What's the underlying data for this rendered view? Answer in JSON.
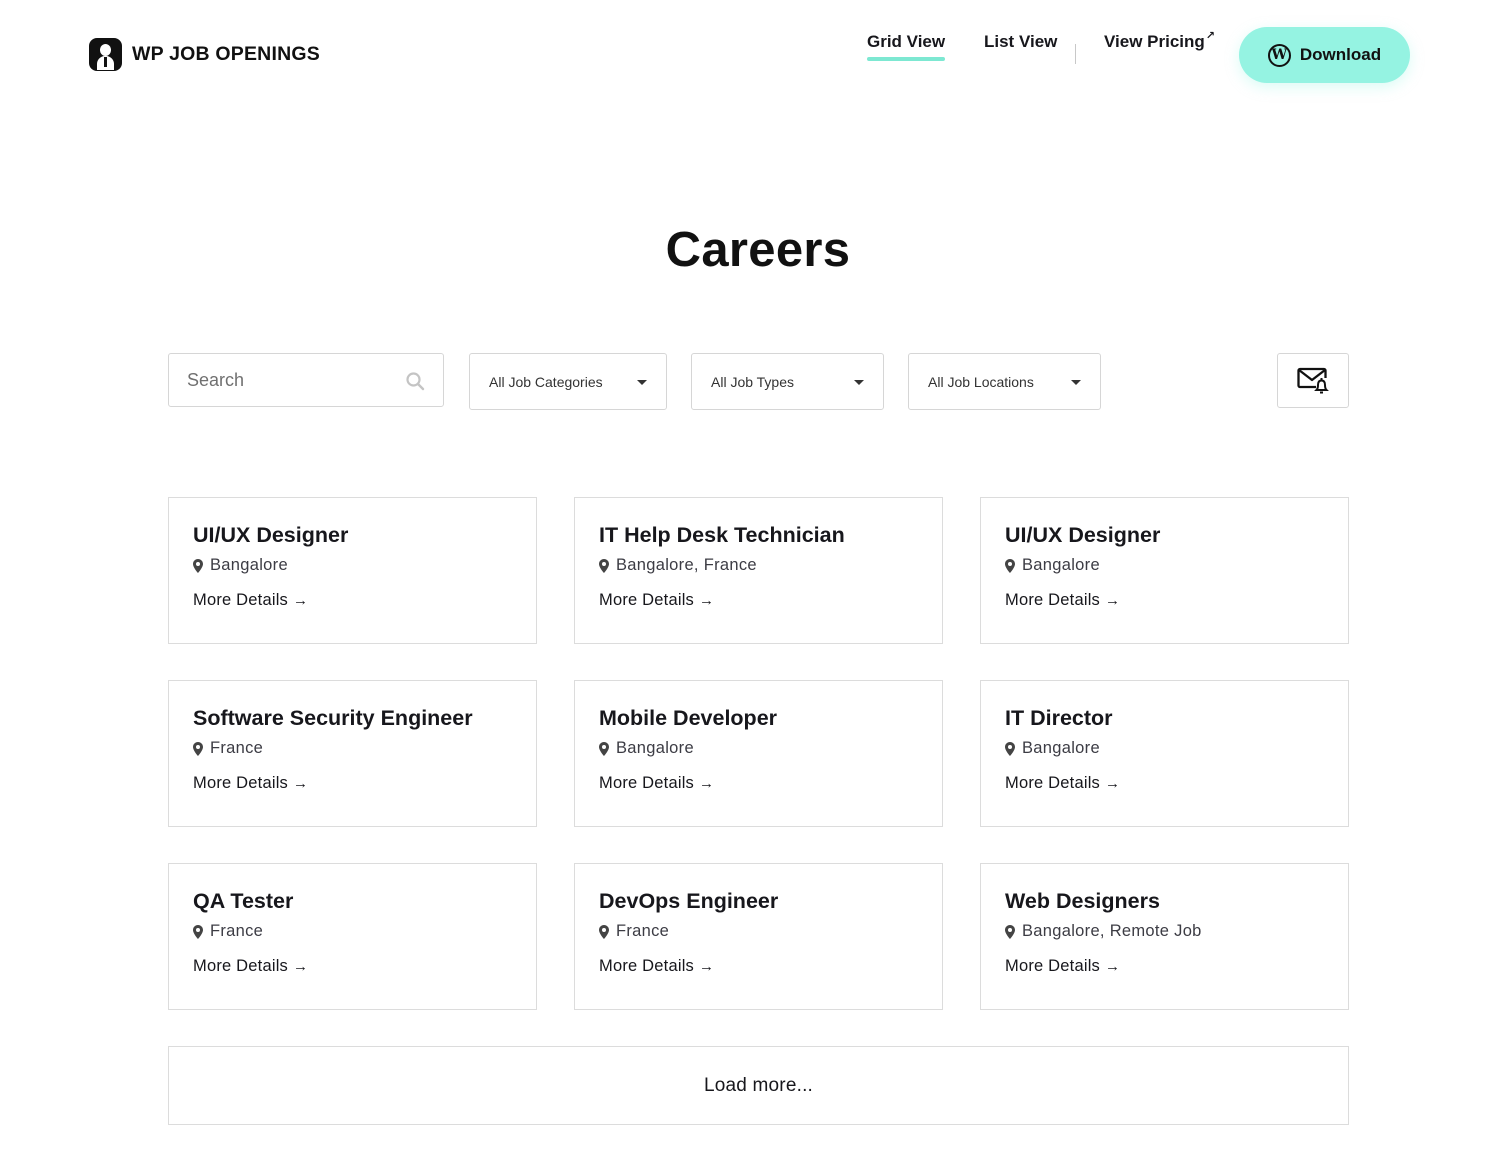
{
  "brand": {
    "name": "WP JOB OPENINGS",
    "logo_icon": "user-badge-icon"
  },
  "nav": {
    "items": [
      {
        "label": "Grid View",
        "active": true
      },
      {
        "label": "List View",
        "active": false
      },
      {
        "label": "View Pricing",
        "external": true
      }
    ],
    "external_icon": "↗",
    "download": {
      "label": "Download",
      "icon": "wordpress-icon",
      "icon_glyph": "W"
    }
  },
  "colors": {
    "accent": "#95f3e2",
    "underline": "#7de8d2",
    "text": "#17171c",
    "border": "#dcdcdc"
  },
  "page": {
    "title": "Careers"
  },
  "filters": {
    "search": {
      "placeholder": "Search",
      "value": ""
    },
    "categories": "All Job Categories",
    "types": "All Job Types",
    "locations": "All Job Locations",
    "alert_icon": "mail-bell-icon"
  },
  "jobs": [
    {
      "title": "UI/UX Designer",
      "location": "Bangalore",
      "link": "More Details"
    },
    {
      "title": "IT Help Desk Technician",
      "location": "Bangalore, France",
      "link": "More Details"
    },
    {
      "title": "UI/UX Designer",
      "location": "Bangalore",
      "link": "More Details"
    },
    {
      "title": "Software Security Engineer",
      "location": "France",
      "link": "More Details"
    },
    {
      "title": "Mobile Developer",
      "location": "Bangalore",
      "link": "More Details"
    },
    {
      "title": "IT Director",
      "location": "Bangalore",
      "link": "More Details"
    },
    {
      "title": "QA Tester",
      "location": "France",
      "link": "More Details"
    },
    {
      "title": "DevOps Engineer",
      "location": "France",
      "link": "More Details"
    },
    {
      "title": "Web Designers",
      "location": "Bangalore, Remote Job",
      "link": "More Details"
    }
  ],
  "arrow": "→",
  "load_more": "Load more..."
}
